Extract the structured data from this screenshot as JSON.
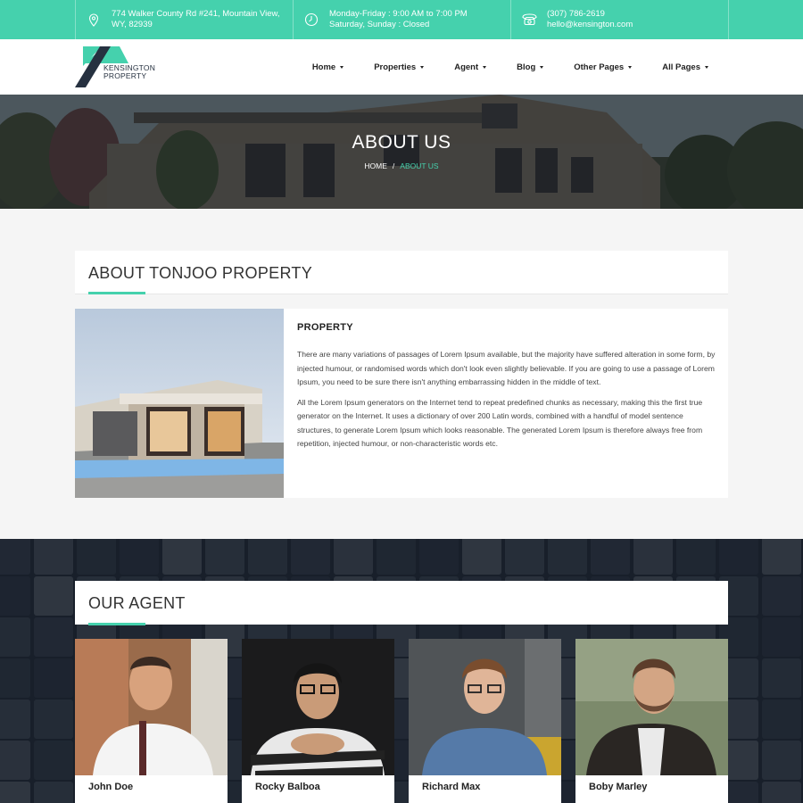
{
  "topbar": {
    "address_line1": "774 Walker County Rd #241, Mountain View,",
    "address_line2": "WY, 82939",
    "hours_line1": "Monday-Friday : 9:00 AM to 7:00 PM",
    "hours_line2": "Saturday, Sunday : Closed",
    "phone": "(307) 786-2619",
    "email": "hello@kensington.com",
    "icons": [
      "map-pin-icon",
      "clock-icon",
      "phone-icon"
    ]
  },
  "brand": {
    "name_line1": "KENSINGTON",
    "name_line2": "PROPERTY",
    "accent_color": "#45d1ad",
    "dark_color": "#263140"
  },
  "nav": {
    "items": [
      {
        "label": "Home"
      },
      {
        "label": "Properties"
      },
      {
        "label": "Agent"
      },
      {
        "label": "Blog"
      },
      {
        "label": "Other Pages"
      },
      {
        "label": "All Pages"
      }
    ]
  },
  "hero": {
    "title": "ABOUT US",
    "breadcrumb": {
      "home": "HOME",
      "separator": "/",
      "current": "ABOUT US"
    }
  },
  "about": {
    "section_title": "ABOUT TONJOO PROPERTY",
    "heading": "PROPERTY",
    "paragraph1": "There are many variations of passages of Lorem Ipsum available, but the majority have suffered alteration in some form, by injected humour, or randomised words which don't look even slightly believable. If you are going to use a passage of Lorem Ipsum, you need to be sure there isn't anything embarrassing hidden in the middle of text.",
    "paragraph2": "All the Lorem Ipsum generators on the Internet tend to repeat predefined chunks as necessary, making this the first true generator on the Internet. It uses a dictionary of over 200 Latin words, combined with a handful of model sentence structures, to generate Lorem Ipsum which looks reasonable. The generated Lorem Ipsum is therefore always free from repetition, injected humour, or non-characteristic words etc."
  },
  "agents": {
    "section_title": "OUR AGENT",
    "list": [
      {
        "name": "John Doe"
      },
      {
        "name": "Rocky Balboa"
      },
      {
        "name": "Richard Max"
      },
      {
        "name": "Boby Marley"
      }
    ]
  }
}
